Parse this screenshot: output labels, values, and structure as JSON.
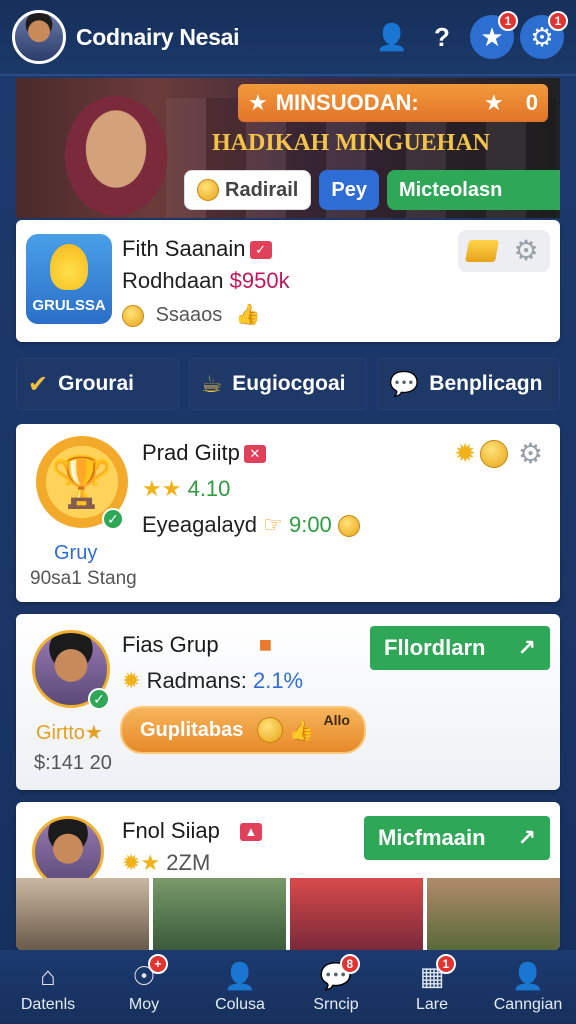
{
  "header": {
    "title": "Codnairy Nesai",
    "icons": [
      "user-icon",
      "help-icon",
      "rocket-icon",
      "gear-icon"
    ],
    "badges": {
      "rocket": "1",
      "gear": "1"
    }
  },
  "hero": {
    "promo_text": "MINSUODAN:",
    "promo_value": "0",
    "subtitle": "HADIKAH MINGUEHAN",
    "buttons": {
      "radiral": "Radirail",
      "pay": "Pey",
      "search": "Micteolasn"
    }
  },
  "card1": {
    "brand": "GRULSSA",
    "title": "Fith Saanain",
    "line2_label": "Rodhdaan",
    "line2_value": "$950k",
    "line3": "Ssaaos"
  },
  "nav": {
    "items": [
      {
        "label": "Grourai"
      },
      {
        "label": "Eugiocgoai"
      },
      {
        "label": "Benplicagn"
      }
    ]
  },
  "card2": {
    "title": "Prad Giitp",
    "rating": "4.10",
    "line3_label": "Eyeagalayd",
    "line3_value": "9:00",
    "group_label": "Gruy",
    "status": "90sa1 Stang"
  },
  "card3": {
    "title": "Fias Grup",
    "line2_label": "Radmans:",
    "line2_value": "2.1%",
    "action": "Fllordlarn",
    "sub_label": "Girtto",
    "amount": "$:141 20",
    "orange_btn": "Guplitabas",
    "orange_tag": "Allo"
  },
  "card4": {
    "title": "Fnol Siiap",
    "value": "2ZM",
    "action": "Micfmaain"
  },
  "bottomnav": {
    "items": [
      {
        "label": "Datenls"
      },
      {
        "label": "Moy"
      },
      {
        "label": "Colusa"
      },
      {
        "label": "Srncip"
      },
      {
        "label": "Lare"
      },
      {
        "label": "Canngian"
      }
    ],
    "badges": {
      "moy": "+",
      "srncip": "8",
      "lare": "1"
    }
  }
}
